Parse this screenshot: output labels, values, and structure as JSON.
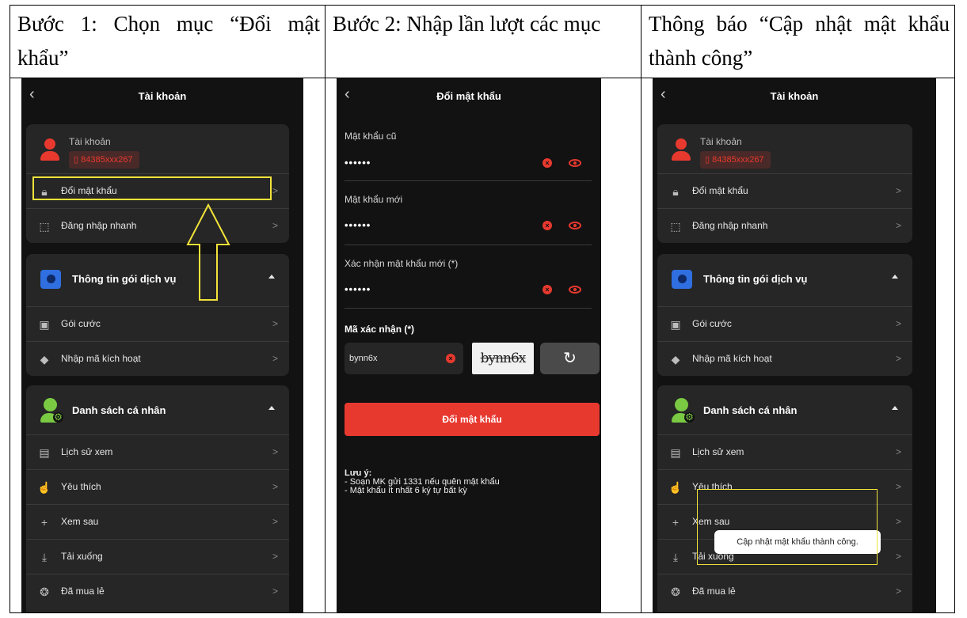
{
  "headers": [
    "Bước 1: Chọn mục “Đổi mật khẩu”",
    "Bước 2: Nhập lần lượt các mục",
    "Thông báo “Cập nhật mật khẩu thành công”"
  ],
  "account_screen": {
    "back_icon": "chevron-left-icon",
    "title": "Tài khoản",
    "account_label": "Tài khoản",
    "phone": "84385xxx267",
    "items": [
      {
        "label": "Đổi mật khẩu",
        "icon": "lock-icon"
      },
      {
        "label": "Đăng nhập nhanh",
        "icon": "scan-icon"
      }
    ],
    "service_section": {
      "title": "Thông tin gói dịch vụ",
      "items": [
        {
          "label": "Gói cước",
          "icon": "package-icon"
        },
        {
          "label": "Nhập mã kích hoạt",
          "icon": "tag-icon"
        }
      ]
    },
    "personal_section": {
      "title": "Danh sách cá nhân",
      "items": [
        {
          "label": "Lịch sử xem",
          "icon": "history-icon"
        },
        {
          "label": "Yêu thích",
          "icon": "thumbs-up-icon"
        },
        {
          "label": "Xem sau",
          "icon": "plus-icon"
        },
        {
          "label": "Tải xuống",
          "icon": "download-icon"
        },
        {
          "label": "Đã mua lẻ",
          "icon": "film-reel-icon"
        }
      ]
    },
    "chevron": ">"
  },
  "change_password_screen": {
    "title": "Đổi mật khẩu",
    "fields": [
      {
        "label": "Mật khẩu cũ",
        "value": "••••••"
      },
      {
        "label": "Mật khẩu mới",
        "value": "••••••"
      },
      {
        "label": "Xác nhận mật khẩu mới (*)",
        "value": "••••••"
      }
    ],
    "captcha_label": "Mã xác nhận (*)",
    "captcha_value": "bynn6x",
    "captcha_image_text": "bynn6x",
    "submit_label": "Đổi mật khẩu",
    "note_title": "Lưu ý:",
    "notes": [
      "- Soạn MK gửi 1331 nếu quên mật khẩu",
      "- Mật khẩu ít nhất 6 ký tự bất kỳ"
    ]
  },
  "toast": "Cập nhật mật khẩu thành công.",
  "colors": {
    "accent": "#e8392f",
    "highlight": "#f2e33a",
    "background": "#121212",
    "card": "#262626"
  }
}
